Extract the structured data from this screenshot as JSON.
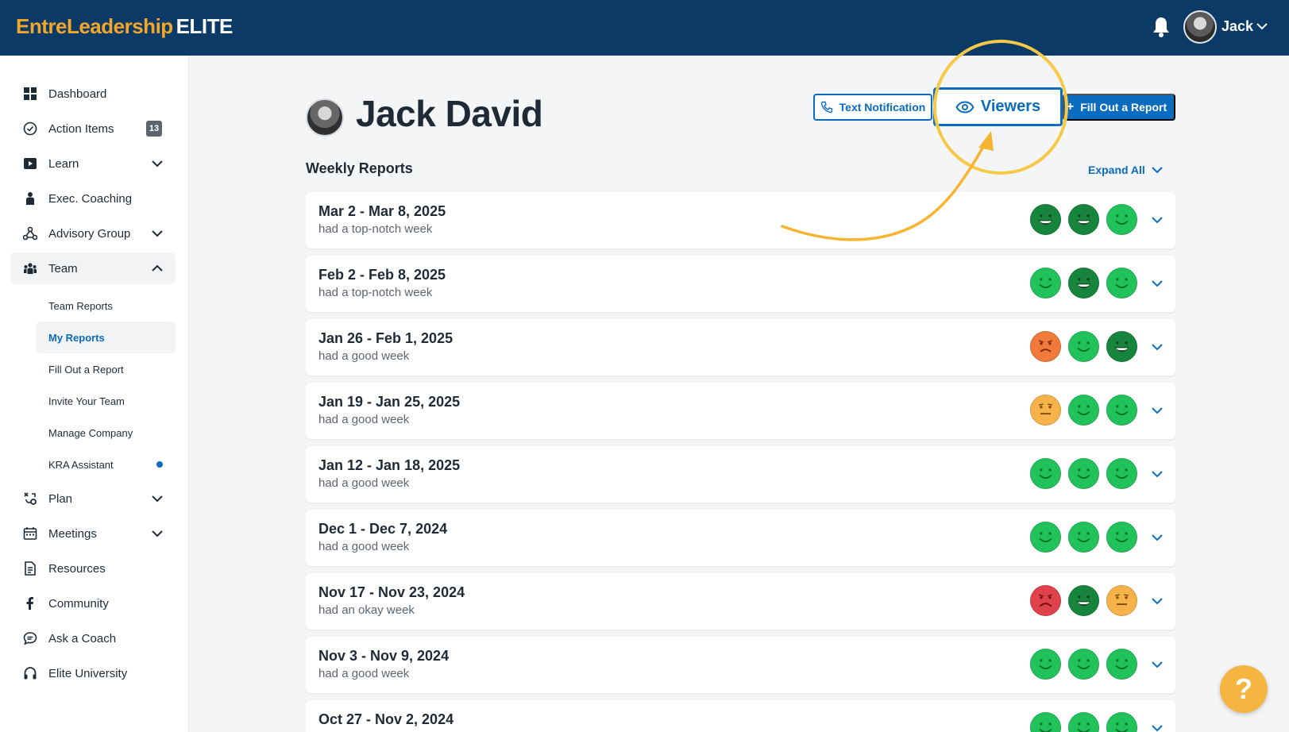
{
  "header": {
    "logo_primary": "EntreLeadership",
    "logo_suffix": "ELITE",
    "user_name": "Jack"
  },
  "sidebar": {
    "items": [
      {
        "label": "Dashboard",
        "icon": "grid-icon"
      },
      {
        "label": "Action Items",
        "icon": "check-circle-icon",
        "badge": "13"
      },
      {
        "label": "Learn",
        "icon": "play-icon",
        "chevron": "down"
      },
      {
        "label": "Exec. Coaching",
        "icon": "coach-icon"
      },
      {
        "label": "Advisory Group",
        "icon": "network-icon",
        "chevron": "down"
      },
      {
        "label": "Team",
        "icon": "team-icon",
        "chevron": "up",
        "expanded": true
      },
      {
        "label": "Plan",
        "icon": "plan-icon",
        "chevron": "down"
      },
      {
        "label": "Meetings",
        "icon": "calendar-icon",
        "chevron": "down"
      },
      {
        "label": "Resources",
        "icon": "document-icon"
      },
      {
        "label": "Community",
        "icon": "facebook-icon"
      },
      {
        "label": "Ask a Coach",
        "icon": "chat-icon"
      },
      {
        "label": "Elite University",
        "icon": "headphones-icon"
      }
    ],
    "team_subitems": [
      {
        "label": "Team Reports"
      },
      {
        "label": "My Reports",
        "active": true
      },
      {
        "label": "Fill Out a Report"
      },
      {
        "label": "Invite Your Team"
      },
      {
        "label": "Manage Company"
      },
      {
        "label": "KRA Assistant",
        "dot": true
      }
    ]
  },
  "main": {
    "title": "Jack David",
    "buttons": {
      "text_notification": "Text Notification",
      "viewers": "Viewers",
      "fill_out": "Fill Out a Report"
    },
    "section_title": "Weekly Reports",
    "expand_all": "Expand All",
    "reports": [
      {
        "date": "Mar 2 - Mar 8, 2025",
        "summary": "had a top-notch week",
        "moods": [
          "great",
          "great",
          "good"
        ]
      },
      {
        "date": "Feb 2 - Feb 8, 2025",
        "summary": "had a top-notch week",
        "moods": [
          "good",
          "great",
          "good"
        ]
      },
      {
        "date": "Jan 26 - Feb 1, 2025",
        "summary": "had a good week",
        "moods": [
          "bad",
          "good",
          "great"
        ]
      },
      {
        "date": "Jan 19 - Jan 25, 2025",
        "summary": "had a good week",
        "moods": [
          "neutral",
          "good",
          "good"
        ]
      },
      {
        "date": "Jan 12 - Jan 18, 2025",
        "summary": "had a good week",
        "moods": [
          "good",
          "good",
          "good"
        ]
      },
      {
        "date": "Dec 1 - Dec 7, 2024",
        "summary": "had a good week",
        "moods": [
          "good",
          "good",
          "good"
        ]
      },
      {
        "date": "Nov 17 - Nov 23, 2024",
        "summary": "had an okay week",
        "moods": [
          "awful",
          "great",
          "neutral"
        ]
      },
      {
        "date": "Nov 3 - Nov 9, 2024",
        "summary": "had a good week",
        "moods": [
          "good",
          "good",
          "good"
        ]
      },
      {
        "date": "Oct 27 - Nov 2, 2024",
        "summary": "",
        "moods": [
          "good",
          "good",
          "good"
        ]
      }
    ]
  },
  "help_button": "?",
  "colors": {
    "header_bg": "#0b3a66",
    "logo_accent": "#f4a62a",
    "primary": "#0b6bbf",
    "highlight": "#f7c948",
    "mood_great": "#16843c",
    "mood_good": "#22c25a",
    "mood_neutral": "#f7b24a",
    "mood_bad": "#f07a3a",
    "mood_awful": "#e0424a"
  }
}
